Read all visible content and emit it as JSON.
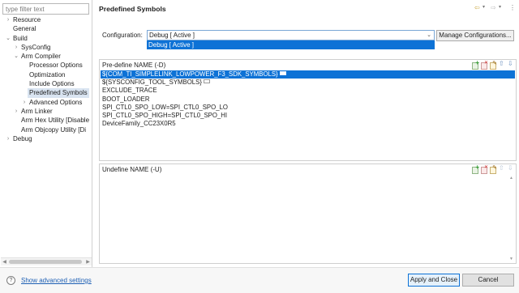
{
  "filter": {
    "placeholder": "type filter text"
  },
  "tree": [
    {
      "label": "Resource",
      "chevron": "›"
    },
    {
      "label": "General",
      "chevron": ""
    },
    {
      "label": "Build",
      "chevron": "⌄"
    },
    {
      "label": "SysConfig",
      "chevron": "›"
    },
    {
      "label": "Arm Compiler",
      "chevron": "⌄"
    },
    {
      "label": "Processor Options",
      "chevron": ""
    },
    {
      "label": "Optimization",
      "chevron": ""
    },
    {
      "label": "Include Options",
      "chevron": ""
    },
    {
      "label": "Predefined Symbols",
      "chevron": ""
    },
    {
      "label": "Advanced Options",
      "chevron": "›"
    },
    {
      "label": "Arm Linker",
      "chevron": "›"
    },
    {
      "label": "Arm Hex Utility  [Disable",
      "chevron": ""
    },
    {
      "label": "Arm Objcopy Utility  [Di",
      "chevron": ""
    },
    {
      "label": "Debug",
      "chevron": "›"
    }
  ],
  "page_title": "Predefined Symbols",
  "configuration": {
    "label": "Configuration:",
    "value": "Debug  [ Active ]",
    "dropdown_option": "Debug  [ Active ]",
    "manage_button": "Manage Configurations..."
  },
  "predefine": {
    "header": "Pre-define NAME (-D)",
    "rows": [
      "${COM_TI_SIMPLELINK_LOWPOWER_F3_SDK_SYMBOLS}",
      "${SYSCONFIG_TOOL_SYMBOLS}",
      "EXCLUDE_TRACE",
      "BOOT_LOADER",
      "SPI_CTL0_SPO_LOW=SPI_CTL0_SPO_LO",
      "SPI_CTL0_SPO_HIGH=SPI_CTL0_SPO_HI",
      "DeviceFamily_CC23X0R5"
    ]
  },
  "undefine": {
    "header": "Undefine NAME (-U)",
    "rows": []
  },
  "bottom": {
    "help_icon": "?",
    "advanced_link": "Show advanced settings",
    "apply_close": "Apply and Close",
    "cancel": "Cancel"
  },
  "colors": {
    "selection": "#0d72d6",
    "link": "#1d5fb4",
    "tree_selection": "#d9e4f1"
  }
}
